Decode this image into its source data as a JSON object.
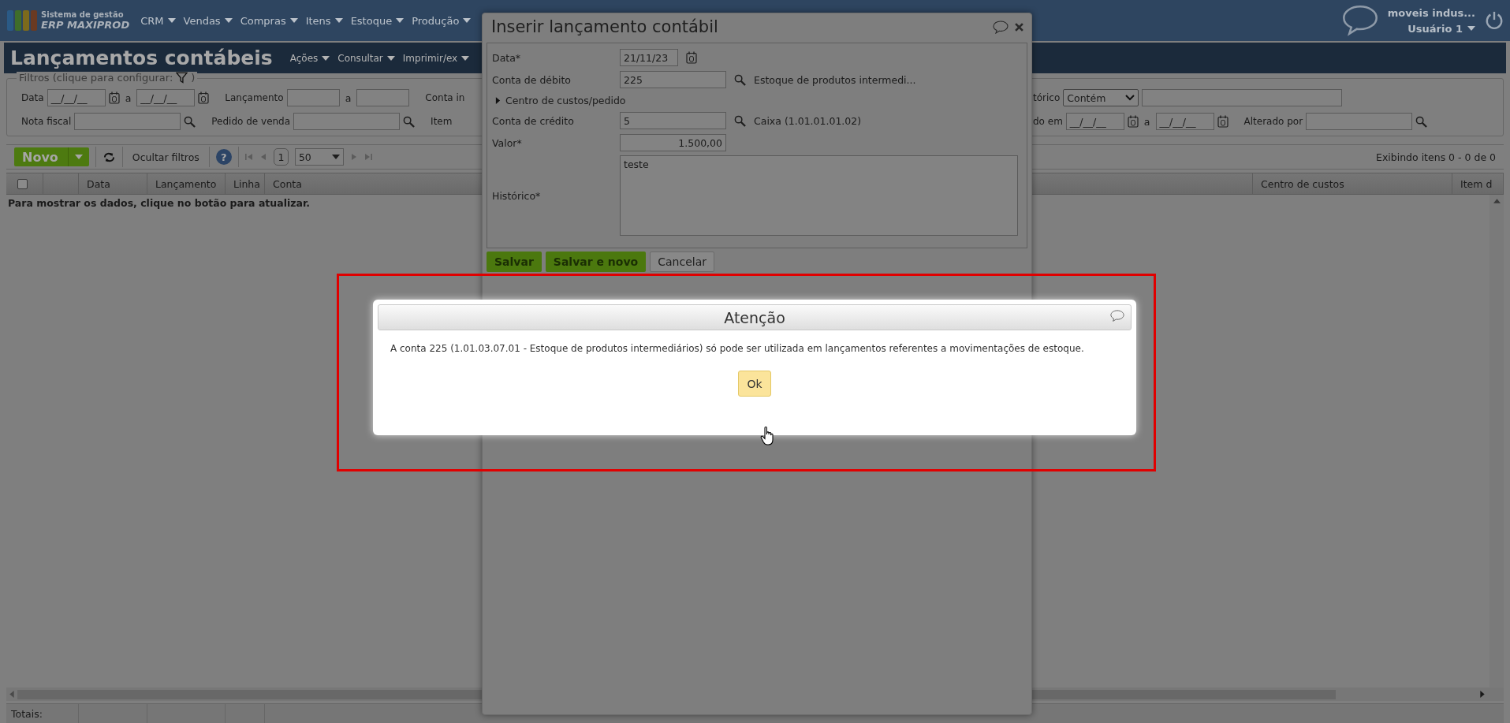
{
  "top_bar": {
    "logo_title": "Sistema de gestão",
    "logo_name": "ERP MAXIPROD",
    "menu": [
      "CRM",
      "Vendas",
      "Compras",
      "Itens",
      "Estoque",
      "Produção"
    ],
    "account": "moveis indus...",
    "user": "Usuário 1"
  },
  "page_header": {
    "title": "Lançamentos contábeis",
    "menu": [
      "Ações",
      "Consultar",
      "Imprimir/ex"
    ]
  },
  "filters": {
    "legend": "Filtros (clique para configurar:",
    "legend_end": ")",
    "rows": [
      {
        "left": [
          {
            "kind": "label",
            "text": "Data"
          },
          {
            "kind": "date",
            "value": "__/__/__"
          },
          {
            "kind": "sep",
            "text": "a"
          },
          {
            "kind": "date",
            "value": "__/__/__"
          },
          {
            "kind": "label",
            "text": "Lançamento"
          },
          {
            "kind": "short_input"
          },
          {
            "kind": "sep",
            "text": "a"
          },
          {
            "kind": "short_input"
          },
          {
            "kind": "label",
            "text": "Conta in"
          }
        ],
        "right": [
          {
            "kind": "label",
            "text": "tórico"
          },
          {
            "kind": "select",
            "value": "Contém"
          },
          {
            "kind": "wide_input"
          }
        ]
      },
      {
        "left": [
          {
            "kind": "label",
            "text": "Nota fiscal"
          },
          {
            "kind": "lookup"
          },
          {
            "kind": "label",
            "text": "Pedido de venda"
          },
          {
            "kind": "lookup"
          },
          {
            "kind": "label",
            "text": "Item"
          }
        ],
        "right": [
          {
            "kind": "label",
            "text": "do em"
          },
          {
            "kind": "date",
            "value": "__/__/__"
          },
          {
            "kind": "sep",
            "text": "a"
          },
          {
            "kind": "date",
            "value": "__/__/__"
          },
          {
            "kind": "label",
            "text": "Alterado por"
          },
          {
            "kind": "lookup"
          }
        ]
      }
    ]
  },
  "toolbar": {
    "new_button": "Novo",
    "hide_filters": "Ocultar filtros",
    "help": "?",
    "page": "1",
    "page_size": "50",
    "summary": "Exibindo itens 0 - 0 de 0"
  },
  "table": {
    "select_all": {
      "checked": false
    },
    "columns": [
      "Data",
      "Lançamento",
      "Linha",
      "Conta",
      "Centro de custos",
      "Item d"
    ],
    "empty_message": "Para mostrar os dados, clique no botão para atualizar.",
    "totals_label": "Totais:"
  },
  "dialog": {
    "title": "Inserir lançamento contábil",
    "fields": [
      {
        "kind": "date",
        "label": "Data*",
        "value": "21/11/23"
      },
      {
        "kind": "lookup",
        "label": "Conta de débito",
        "value": "225",
        "description": "Estoque de produtos intermedi..."
      },
      {
        "kind": "expander",
        "label": "Centro de custos/pedido",
        "expanded": false
      },
      {
        "kind": "lookup",
        "label": "Conta de crédito",
        "value": "5",
        "description": "Caixa (1.01.01.01.02)"
      },
      {
        "kind": "amount",
        "label": "Valor*",
        "value": "1.500,00"
      },
      {
        "kind": "textarea",
        "label": "Histórico*",
        "value": "teste"
      }
    ],
    "buttons": [
      {
        "label": "Salvar",
        "kind": "primary"
      },
      {
        "label": "Salvar e novo",
        "kind": "primary"
      },
      {
        "label": "Cancelar",
        "kind": "secondary"
      }
    ]
  },
  "alert": {
    "title": "Atenção",
    "message": "A conta 225 (1.01.03.07.01 - Estoque de produtos intermediários) só pode ser utilizada em lançamentos referentes a movimentações de estoque.",
    "button": "Ok"
  }
}
